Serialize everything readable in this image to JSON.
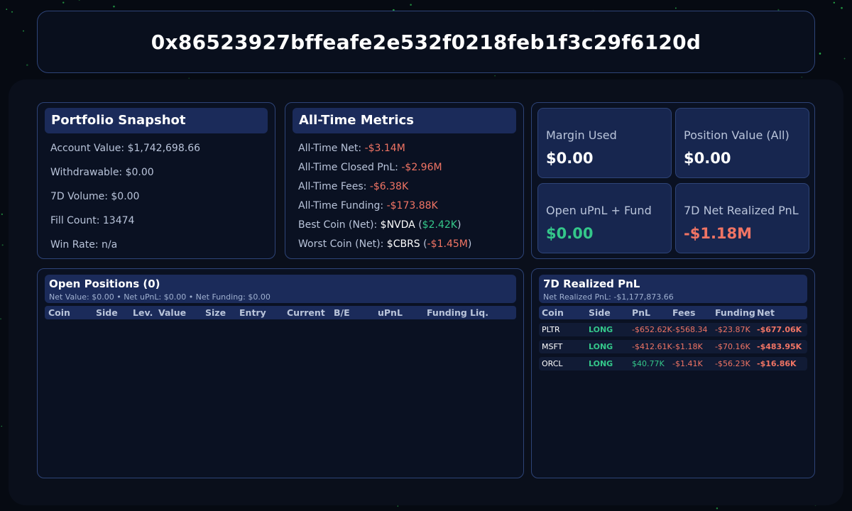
{
  "header": {
    "address": "0x86523927bffeafe2e532f0218feb1f3c29f6120d"
  },
  "snapshot": {
    "title": "Portfolio Snapshot",
    "rows": [
      "Account Value: $1,742,698.66",
      "Withdrawable: $0.00",
      "7D Volume: $0.00",
      "Fill Count: 13474",
      "Win Rate: n/a"
    ]
  },
  "metrics": {
    "title": "All-Time Metrics",
    "net_label": "All-Time Net: ",
    "net_value": "-$3.14M",
    "closed_label": "All-Time Closed PnL: ",
    "closed_value": "-$2.96M",
    "fees_label": "All-Time Fees: ",
    "fees_value": "-$6.38K",
    "funding_label": "All-Time Funding: ",
    "funding_value": "-$173.88K",
    "best_label": "Best Coin (Net): ",
    "best_coin": "$NVDA",
    "best_value": "$2.42K",
    "worst_label": "Worst Coin (Net): ",
    "worst_coin": "$CBRS",
    "worst_value": "-$1.45M",
    "paren_open": " (",
    "paren_close": ")"
  },
  "stats": {
    "margin_label": "Margin Used",
    "margin_value": "$0.00",
    "position_label": "Position Value (All)",
    "position_value": "$0.00",
    "upnl_label": "Open uPnL + Fund",
    "upnl_value": "$0.00",
    "realized_label": "7D Net Realized PnL",
    "realized_value": "-$1.18M"
  },
  "open_positions": {
    "title": "Open Positions (0)",
    "subtitle": "Net Value: $0.00 • Net uPnL: $0.00 • Net Funding: $0.00",
    "columns": [
      "Coin",
      "Side",
      "Lev.",
      "Value",
      "Size",
      "Entry",
      "Current",
      "B/E",
      "uPnL",
      "Funding",
      "Liq."
    ]
  },
  "realized": {
    "title": "7D Realized PnL",
    "subtitle": "Net Realized PnL: -$1,177,873.66",
    "columns": [
      "Coin",
      "Side",
      "PnL",
      "Fees",
      "Funding",
      "Net"
    ],
    "rows": [
      {
        "coin": "PLTR",
        "side": "LONG",
        "pnl": "-$652.62K",
        "fees": "-$568.34",
        "funding": "-$23.87K",
        "net": "-$677.06K"
      },
      {
        "coin": "MSFT",
        "side": "LONG",
        "pnl": "-$412.61K",
        "fees": "-$1.18K",
        "funding": "-$70.16K",
        "net": "-$483.95K"
      },
      {
        "coin": "ORCL",
        "side": "LONG",
        "pnl": "$40.77K",
        "fees": "-$1.41K",
        "funding": "-$56.23K",
        "net": "-$16.86K"
      }
    ]
  },
  "colors": {
    "background": "#060a12",
    "panel_border": "#2e4478",
    "title_bar": "#1b2b5a",
    "positive": "#34c78a",
    "negative": "#f07464",
    "star": "#2ecc55"
  },
  "icons": [
    "star-icon"
  ]
}
